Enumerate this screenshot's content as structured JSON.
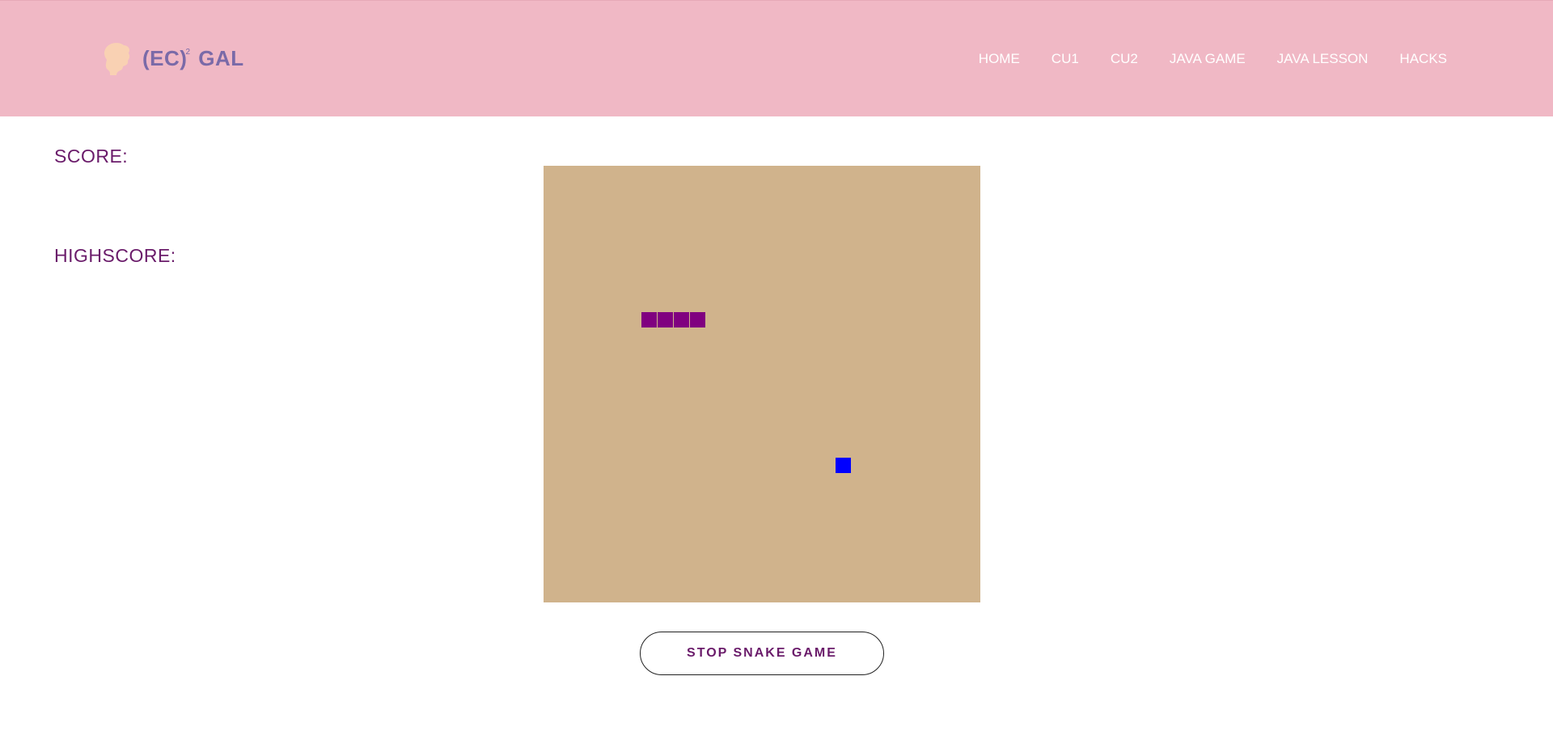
{
  "header": {
    "logo_text": "(EC)",
    "logo_superscript": "2",
    "logo_suffix": "GAL",
    "logo_icon": "woman-profile-icon",
    "nav": [
      {
        "label": "HOME"
      },
      {
        "label": "CU1"
      },
      {
        "label": "CU2"
      },
      {
        "label": "JAVA GAME"
      },
      {
        "label": "JAVA LESSON"
      },
      {
        "label": "HACKS"
      }
    ],
    "colors": {
      "background": "#f0b8c5",
      "logo": "#7a6aa8",
      "nav_text": "#ffffff"
    }
  },
  "scoreboard": {
    "score_label": "SCORE:",
    "score_value": "",
    "highscore_label": "HIGHSCORE:",
    "highscore_value": ""
  },
  "game": {
    "grid_columns": 27,
    "grid_rows": 27,
    "snake": [
      {
        "col": 6,
        "row": 9
      },
      {
        "col": 7,
        "row": 9
      },
      {
        "col": 8,
        "row": 9
      },
      {
        "col": 9,
        "row": 9
      }
    ],
    "food": {
      "col": 18,
      "row": 18
    },
    "colors": {
      "board": "#d0b38c",
      "snake": "#800080",
      "food": "#0000ff"
    }
  },
  "controls": {
    "stop_label": "STOP SNAKE GAME"
  }
}
